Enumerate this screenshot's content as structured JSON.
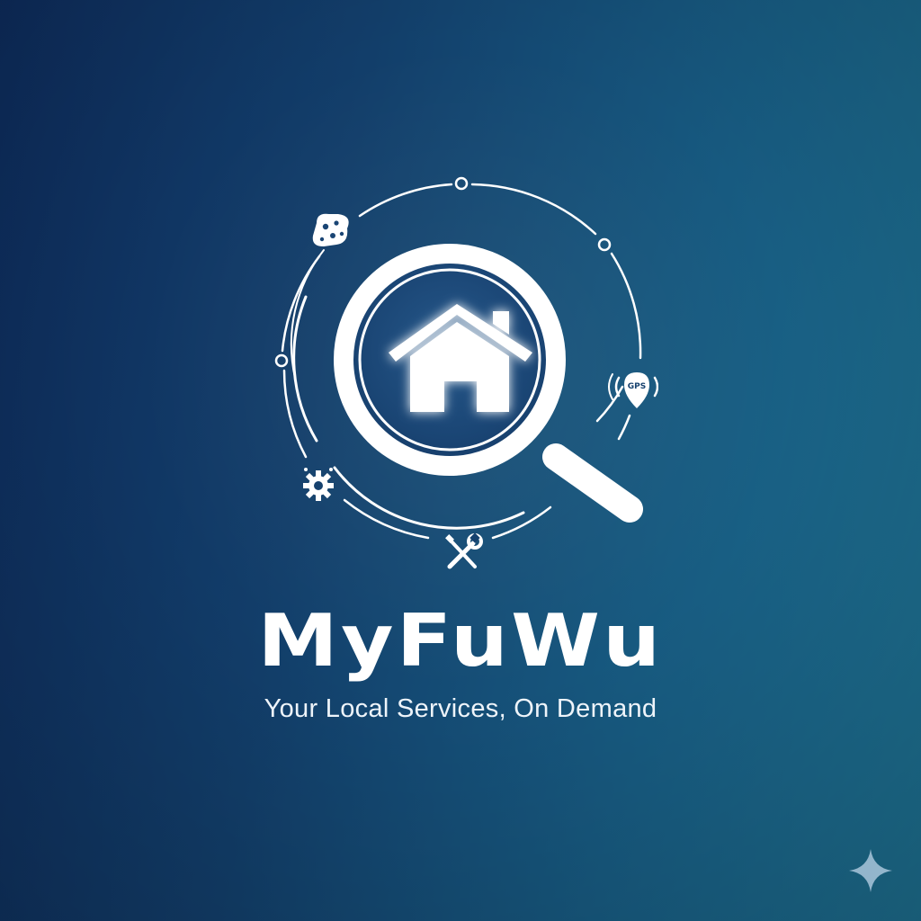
{
  "brand": {
    "name": "MyFuWu",
    "tagline": "Your Local Services, On Demand"
  },
  "emblem": {
    "icons": [
      "magnifying-glass-icon",
      "house-icon",
      "sponge-icon",
      "gear-icon",
      "wrench-screwdriver-icon",
      "gps-pin-icon"
    ],
    "gps_label": "GPS"
  },
  "colors": {
    "background_start": "#0d2b5a",
    "background_end": "#1d6f8f",
    "foreground": "#ffffff",
    "glass_fill": "#1a4574"
  }
}
